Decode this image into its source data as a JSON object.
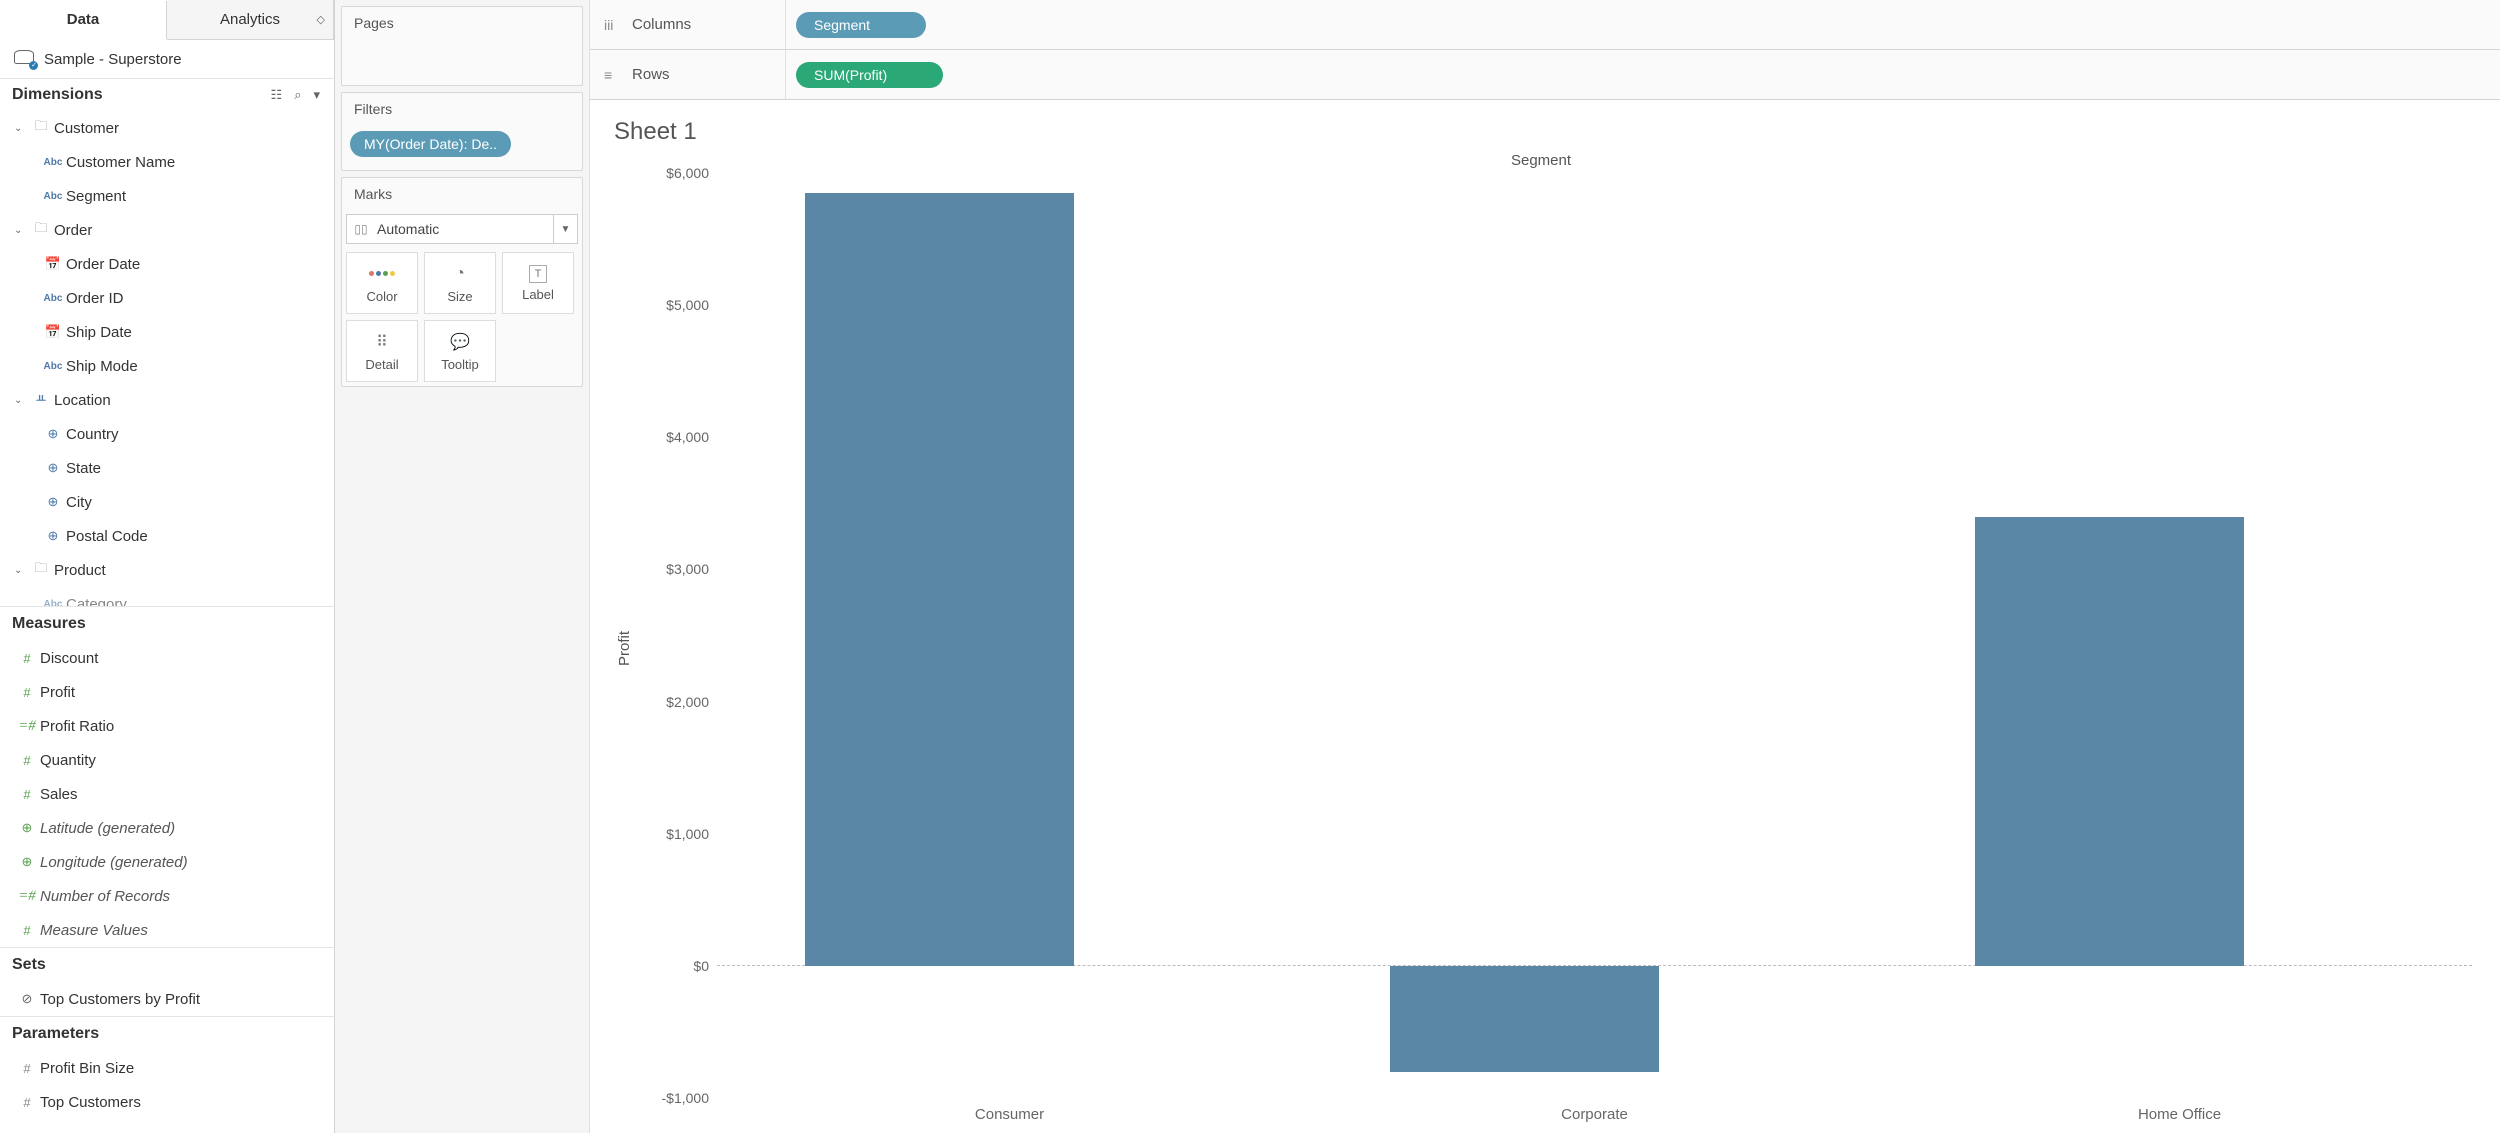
{
  "tabs": {
    "data": "Data",
    "analytics": "Analytics"
  },
  "datasource": "Sample - Superstore",
  "sections": {
    "dimensions": "Dimensions",
    "measures": "Measures",
    "sets": "Sets",
    "parameters": "Parameters"
  },
  "dim_tree": {
    "customer": {
      "label": "Customer",
      "children": {
        "customer_name": "Customer Name",
        "segment": "Segment"
      }
    },
    "order": {
      "label": "Order",
      "children": {
        "order_date": "Order Date",
        "order_id": "Order ID",
        "ship_date": "Ship Date",
        "ship_mode": "Ship Mode"
      }
    },
    "location": {
      "label": "Location",
      "children": {
        "country": "Country",
        "state": "State",
        "city": "City",
        "postal_code": "Postal Code"
      }
    },
    "product": {
      "label": "Product",
      "children": {
        "category": "Category"
      }
    }
  },
  "measures_list": {
    "discount": "Discount",
    "profit": "Profit",
    "profit_ratio": "Profit Ratio",
    "quantity": "Quantity",
    "sales": "Sales",
    "latitude": "Latitude (generated)",
    "longitude": "Longitude (generated)",
    "num_records": "Number of Records",
    "measure_values": "Measure Values"
  },
  "sets_list": {
    "top_customers": "Top Customers by Profit"
  },
  "params_list": {
    "profit_bin": "Profit Bin Size",
    "top_customers_p": "Top Customers"
  },
  "cards": {
    "pages": "Pages",
    "filters": "Filters",
    "filter_pill": "MY(Order Date): De..",
    "marks": "Marks",
    "marks_type": "Automatic",
    "mark_cells": {
      "color": "Color",
      "size": "Size",
      "label": "Label",
      "detail": "Detail",
      "tooltip": "Tooltip"
    }
  },
  "shelves": {
    "columns": "Columns",
    "rows": "Rows",
    "col_pill": "Segment",
    "row_pill": "SUM(Profit)"
  },
  "sheet_title": "Sheet 1",
  "chart_data": {
    "type": "bar",
    "title": "Sheet 1",
    "column_header": "Segment",
    "ylabel": "Profit",
    "categories": [
      "Consumer",
      "Corporate",
      "Home Office"
    ],
    "values": [
      5850,
      -800,
      3400
    ],
    "ylim": [
      -1000,
      6000
    ],
    "yticks": [
      -1000,
      0,
      1000,
      2000,
      3000,
      4000,
      5000,
      6000
    ],
    "ytick_labels": [
      "-$1,000",
      "$0",
      "$1,000",
      "$2,000",
      "$3,000",
      "$4,000",
      "$5,000",
      "$6,000"
    ]
  }
}
